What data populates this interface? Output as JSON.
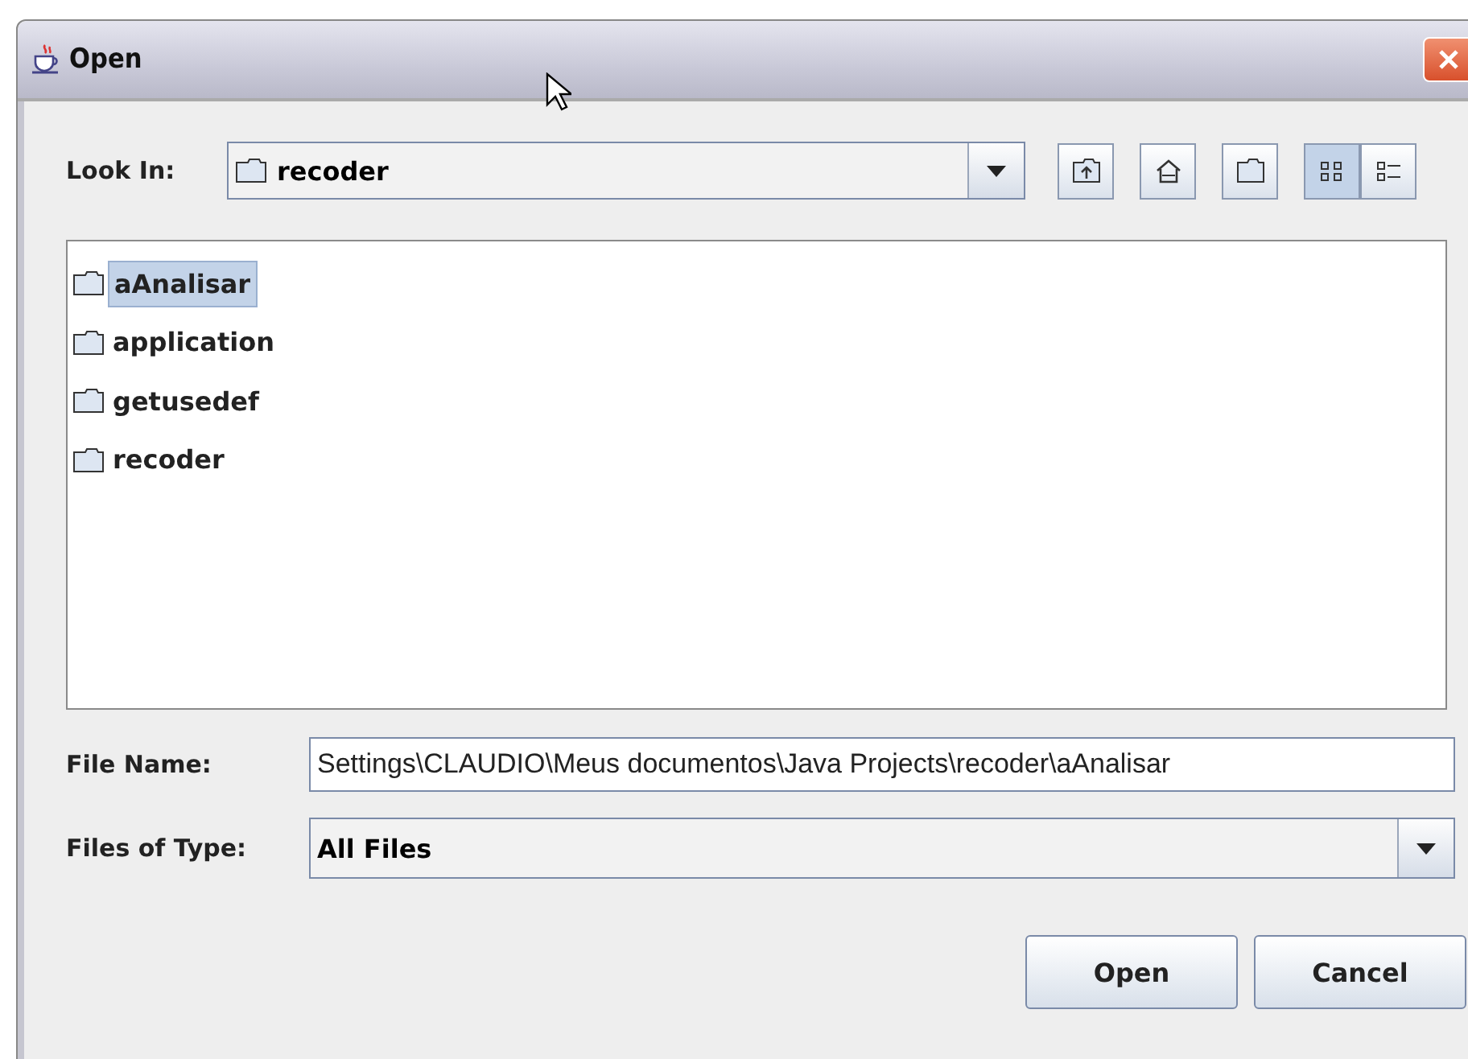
{
  "window": {
    "title": "Open"
  },
  "look_in": {
    "label": "Look In:",
    "value": "recoder"
  },
  "toolbar": [
    {
      "kind": "up",
      "selected": false
    },
    {
      "kind": "home",
      "selected": false
    },
    {
      "kind": "newfolder",
      "selected": false
    },
    {
      "kind": "list",
      "selected": true
    },
    {
      "kind": "details",
      "selected": false
    }
  ],
  "files": [
    {
      "name": "aAnalisar",
      "selected": true
    },
    {
      "name": "application",
      "selected": false
    },
    {
      "name": "getusedef",
      "selected": false
    },
    {
      "name": "recoder",
      "selected": false
    }
  ],
  "file_name": {
    "label": "File Name:",
    "value": "Settings\\CLAUDIO\\Meus documentos\\Java Projects\\recoder\\aAnalisar"
  },
  "file_type": {
    "label": "Files of Type:",
    "value": "All Files"
  },
  "buttons": [
    "Open",
    "Cancel"
  ]
}
